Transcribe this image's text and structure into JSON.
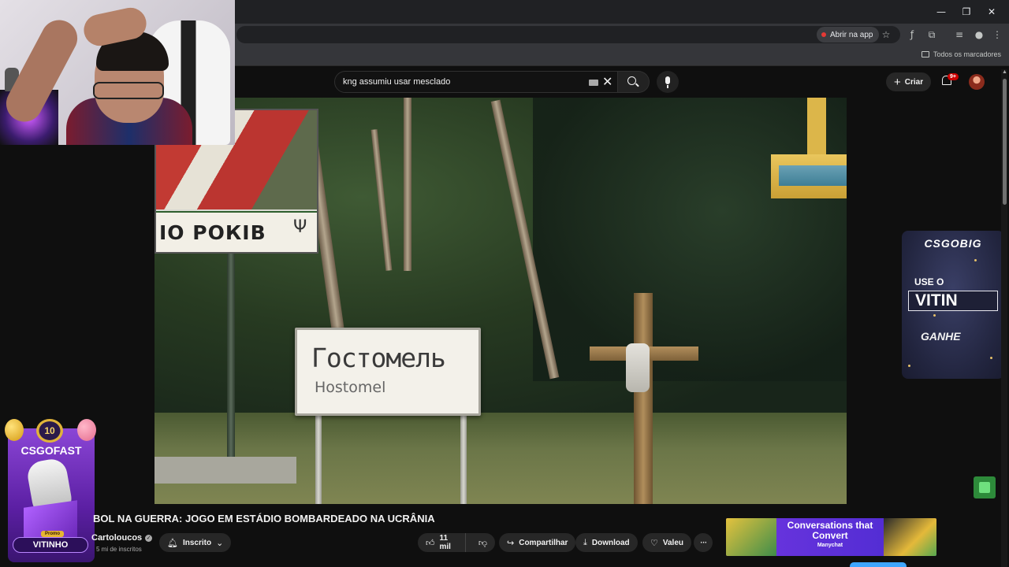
{
  "browser": {
    "open_in_app": "Abrir na app",
    "all_bookmarks": "Todos os marcadores"
  },
  "youtube": {
    "search_value": "kng assumiu usar mesclado",
    "create_label": "Criar",
    "notification_count": "9+"
  },
  "video_frame": {
    "billboard_text": "IO РОКІВ",
    "city_sign_cyrillic": "Гостомель",
    "city_sign_latin": "Hostomel"
  },
  "video": {
    "title": "BOL NA GUERRA: JOGO EM ESTÁDIO BOMBARDEADO NA UCRÂNIA",
    "channel": "Cartoloucos",
    "subscribers": "5 mi de inscritos",
    "subscribed_label": "Inscrito",
    "likes": "11 mil",
    "share_label": "Compartilhar",
    "download_label": "Download",
    "thanks_label": "Valeu"
  },
  "ads": {
    "csgofast": {
      "badge": "10",
      "title": "CSGOFAST",
      "promo": "Promo",
      "code": "VITINHO"
    },
    "csgobig": {
      "logo": "CSGOBIG",
      "use_label": "USE O",
      "code": "VITIN",
      "reward_label": "GANHE"
    },
    "manychat": {
      "headline": "Conversations that Convert",
      "brand": "Manychat"
    }
  },
  "icons": {
    "minimize": "minimize-icon",
    "restore": "restore-icon",
    "close": "close-icon",
    "star": "star-icon",
    "extensions": "puzzle-icon",
    "search": "search-icon",
    "mic": "mic-icon",
    "bell": "bell-icon"
  }
}
